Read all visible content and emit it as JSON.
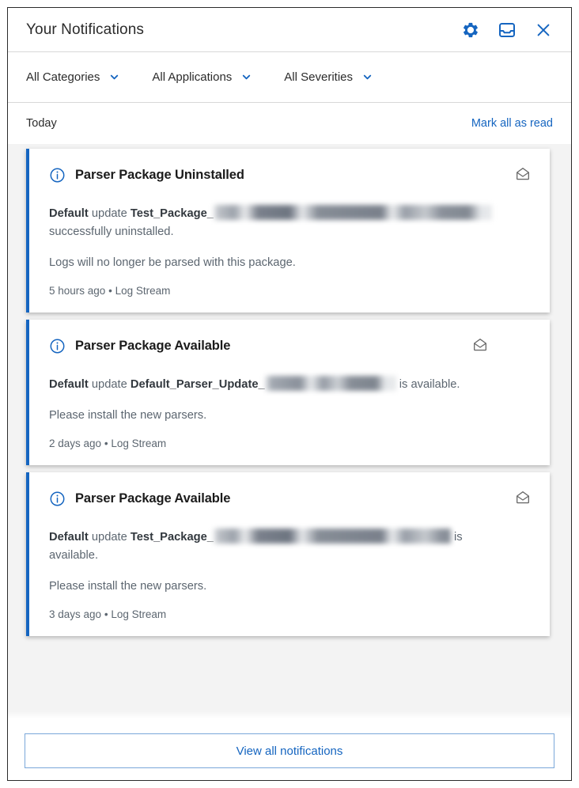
{
  "header": {
    "title": "Your Notifications",
    "actions": [
      {
        "name": "settings-icon",
        "label": "Settings"
      },
      {
        "name": "inbox-icon",
        "label": "Inbox"
      },
      {
        "name": "close-icon",
        "label": "Close"
      }
    ]
  },
  "filters": [
    {
      "label": "All Categories",
      "name": "filter-categories"
    },
    {
      "label": "All Applications",
      "name": "filter-applications"
    },
    {
      "label": "All Severities",
      "name": "filter-severities"
    }
  ],
  "section": {
    "label": "Today",
    "mark_all_label": "Mark all as read"
  },
  "notifications": [
    {
      "severity_icon": "info-icon",
      "title": "Parser Package Uninstalled",
      "body_prefix_bold": "Default",
      "body_mid": " update ",
      "body_pkg_bold": "Test_Package_",
      "redacted": true,
      "redaction_style": "long",
      "body_suffix": "",
      "body_second_line": "successfully uninstalled.",
      "detail": "Logs will no longer be parsed with this package.",
      "time": "5 hours ago",
      "source": "Log Stream",
      "separator": "•",
      "read_state": "unread",
      "mail_icon": "envelope-icon"
    },
    {
      "severity_icon": "info-icon",
      "title": "Parser Package Available",
      "body_prefix_bold": "Default",
      "body_mid": " update ",
      "body_pkg_bold": "Default_Parser_Update_",
      "redacted": true,
      "redaction_style": "short",
      "body_suffix": " is available.",
      "body_second_line": "",
      "detail": "Please install the new parsers.",
      "time": "2 days ago",
      "source": "Log Stream",
      "separator": "•",
      "read_state": "unread",
      "mail_icon": "envelope-icon"
    },
    {
      "severity_icon": "info-icon",
      "title": "Parser Package Available",
      "body_prefix_bold": "Default",
      "body_mid": " update ",
      "body_pkg_bold": "Test_Package_",
      "redacted": true,
      "redaction_style": "long",
      "body_suffix": " is",
      "body_second_line": "available.",
      "detail": "Please install the new parsers.",
      "time": "3 days ago",
      "source": "Log Stream",
      "separator": "•",
      "read_state": "unread",
      "mail_icon": "envelope-icon"
    }
  ],
  "footer": {
    "view_all_label": "View all notifications"
  },
  "colors": {
    "accent": "#1565c0",
    "link": "#1565c0",
    "card_accent_bar": "#1565c0",
    "body_text": "#5c6670",
    "title_text": "#1b1b1b",
    "panel_border": "#2b2b2b",
    "list_background": "#f3f3f3",
    "button_border": "#7aa7d9"
  }
}
